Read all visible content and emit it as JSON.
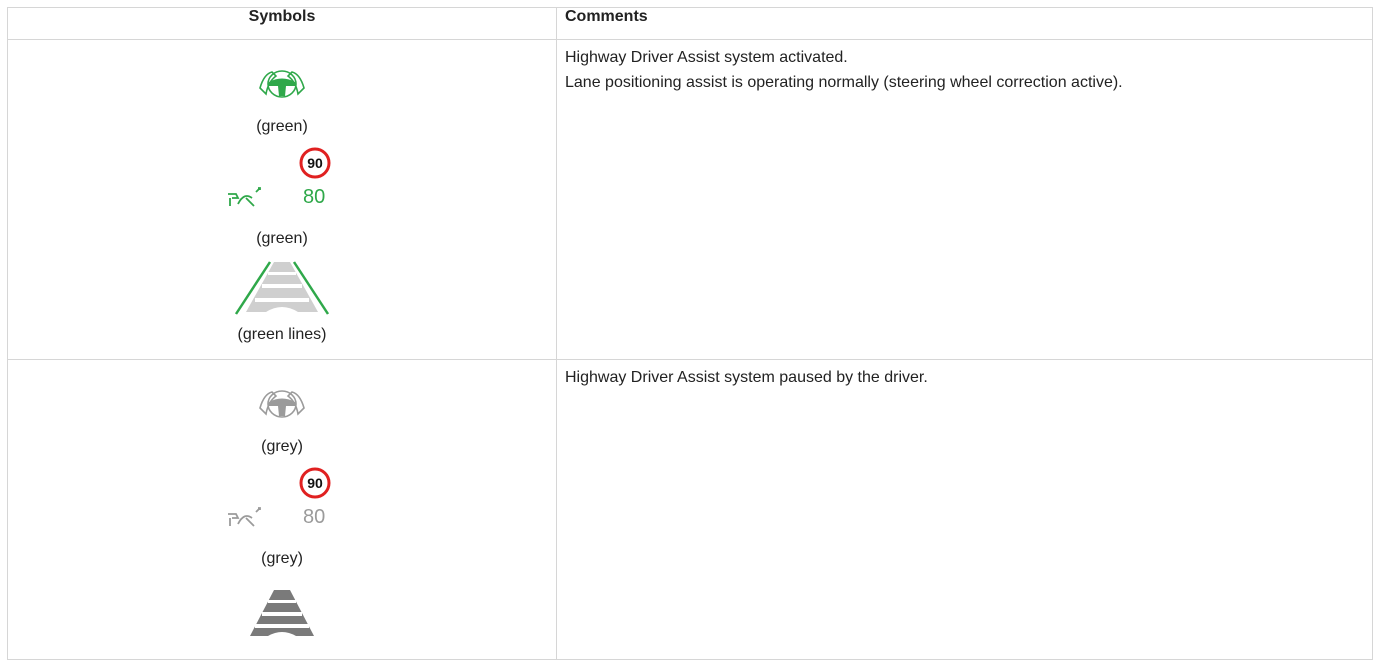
{
  "table": {
    "headers": {
      "symbols": "Symbols",
      "comments": "Comments"
    },
    "rows": [
      {
        "state": "green",
        "captions": [
          "(green)",
          "(green)",
          "(green lines)"
        ],
        "speed_limit": "90",
        "set_speed": "80",
        "comments": [
          "Highway Driver Assist system activated.",
          "Lane positioning assist is operating normally (steering wheel correction active)."
        ],
        "icons": [
          "hands-on-steering-wheel-icon",
          "speed-limit-sign-icon",
          "cruise-control-icon",
          "lane-road-icon"
        ]
      },
      {
        "state": "grey",
        "captions": [
          "(grey)",
          "(grey)"
        ],
        "speed_limit": "90",
        "set_speed": "80",
        "comments": [
          "Highway Driver Assist system paused by the driver."
        ],
        "icons": [
          "hands-on-steering-wheel-icon",
          "speed-limit-sign-icon",
          "cruise-control-icon",
          "lane-road-icon"
        ]
      }
    ]
  },
  "colors": {
    "active": "#2fa84a",
    "inactive": "#9b9b9b",
    "sign_ring": "#e02020",
    "road_grey": "#cfcfcf",
    "road_dark": "#7a7a7a"
  }
}
